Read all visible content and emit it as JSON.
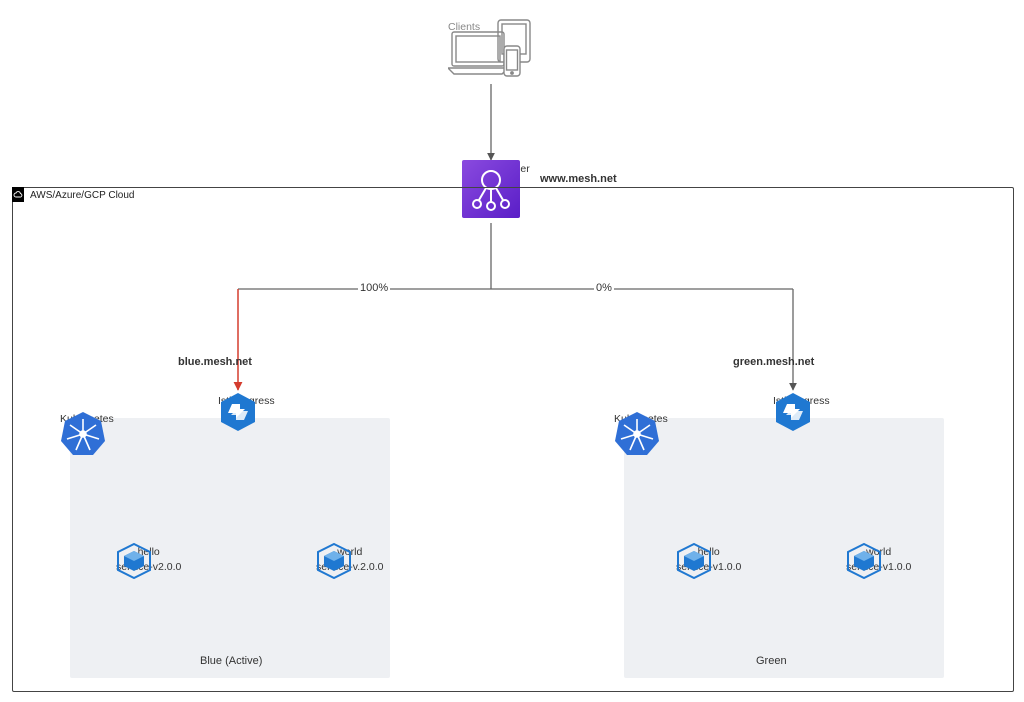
{
  "clients_label": "Clients",
  "lb_label": "Load Balancer",
  "lb_domain": "www.mesh.net",
  "cloud_label": "AWS/Azure/GCP Cloud",
  "traffic_left": "100%",
  "traffic_right": "0%",
  "blue_domain": "blue.mesh.net",
  "green_domain": "green.mesh.net",
  "ingress_label": "Istio Ingress",
  "k8s_label": "Kubernetes",
  "blue_env_title": "Blue (Active)",
  "green_env_title": "Green",
  "blue_svc1_name": "hello",
  "blue_svc1_ver": "service-v2.0.0",
  "blue_svc2_name": "world",
  "blue_svc2_ver": "service-v.2.0.0",
  "green_svc1_name": "hello",
  "green_svc1_ver": "service-v1.0.0",
  "green_svc2_name": "world",
  "green_svc2_ver": "service-v1.0.0"
}
